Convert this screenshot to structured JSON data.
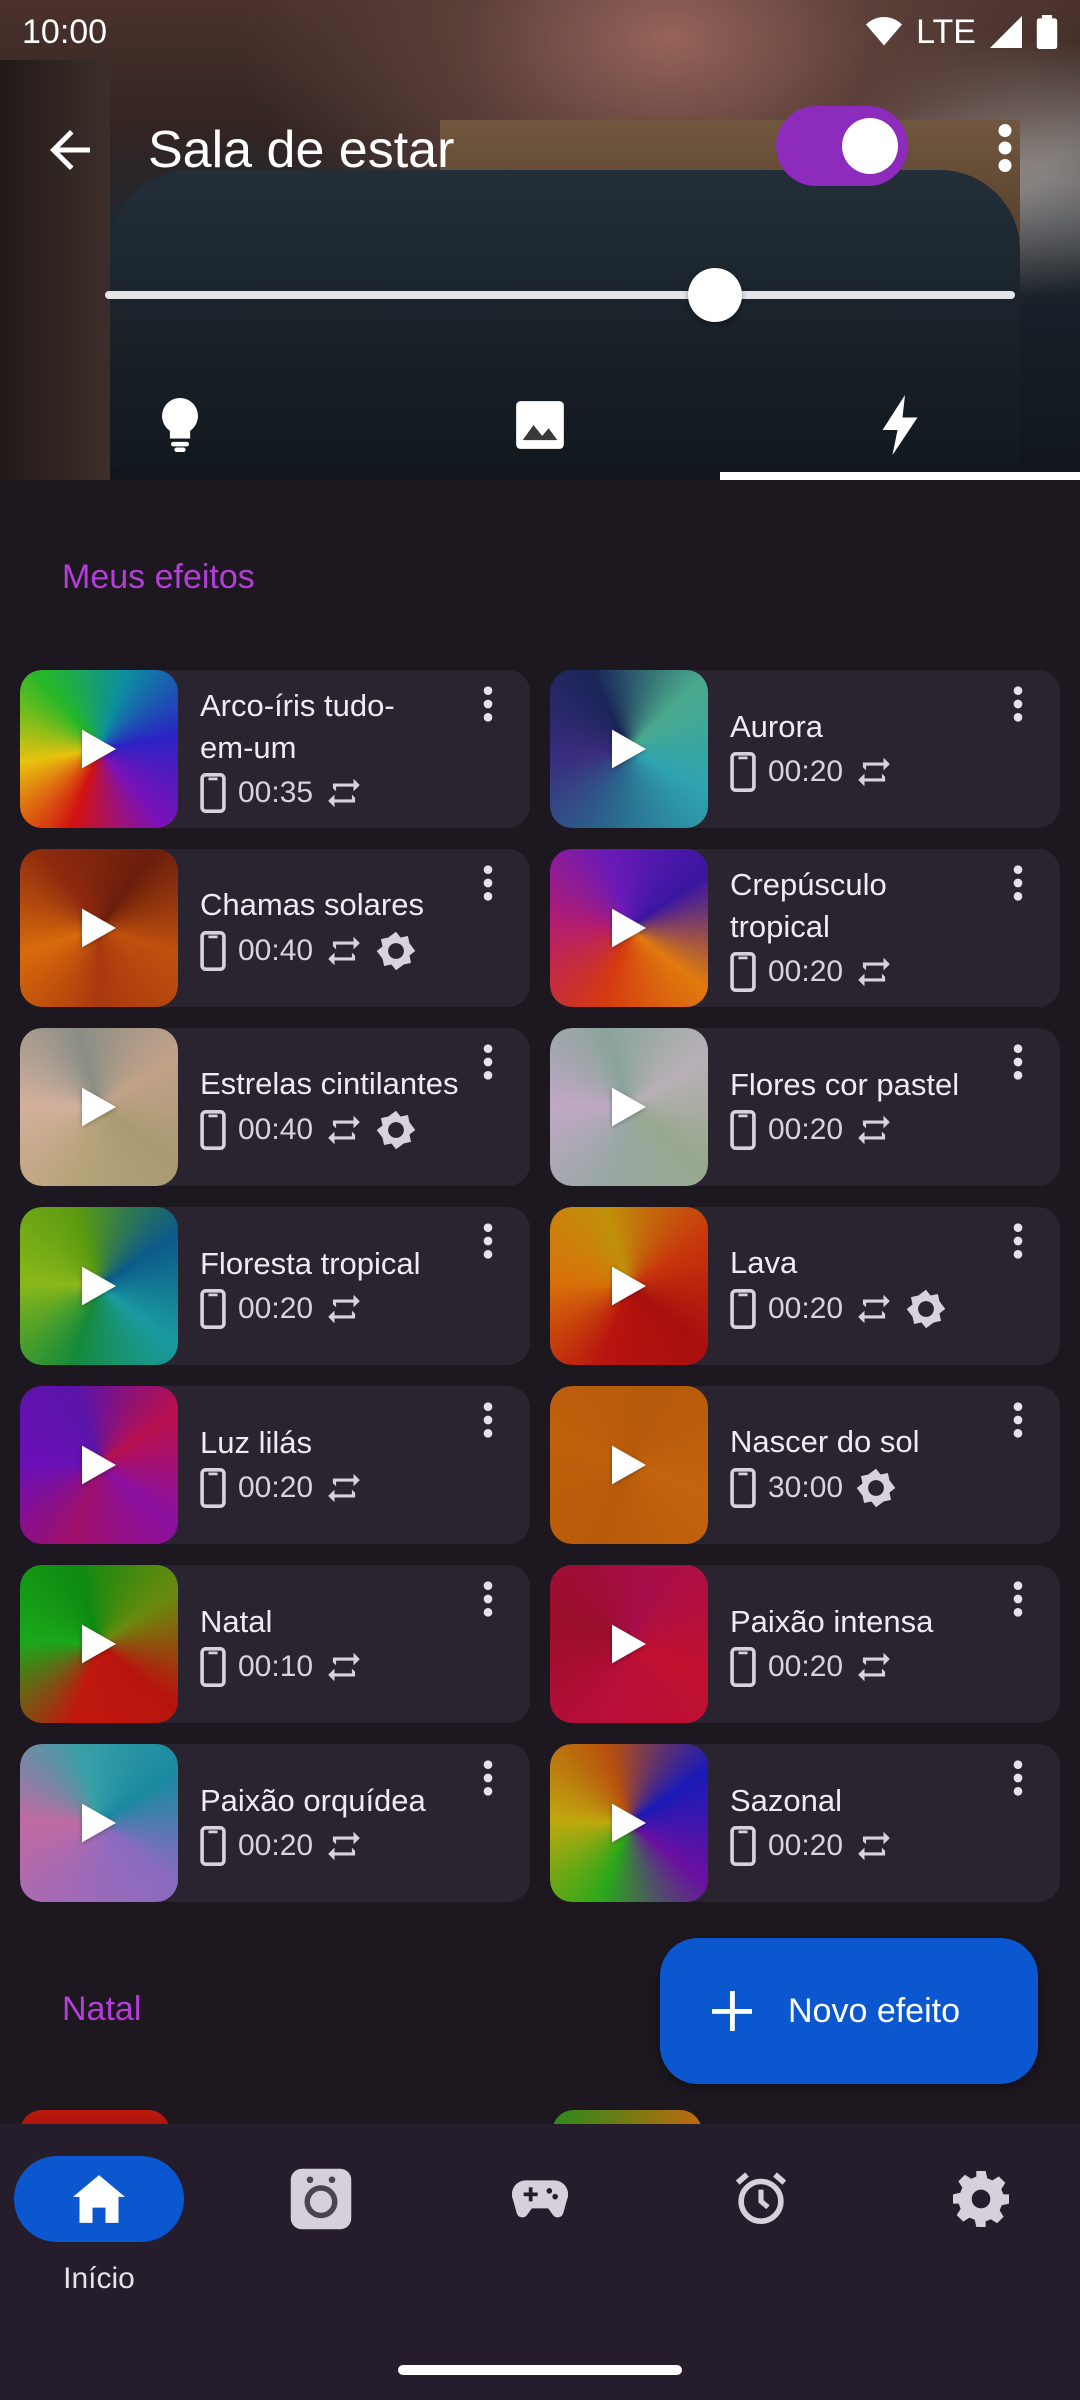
{
  "status_bar": {
    "time": "10:00",
    "network": "LTE",
    "icons": [
      "wifi-icon",
      "signal-icon",
      "battery-icon"
    ]
  },
  "header": {
    "title": "Sala de estar",
    "power_on": true,
    "brightness_fraction": 0.67
  },
  "tabs": [
    {
      "icon": "lightbulb-icon",
      "active": false
    },
    {
      "icon": "image-icon",
      "active": false
    },
    {
      "icon": "bolt-icon",
      "active": true
    }
  ],
  "section_my_effects": "Meus efeitos",
  "effects": [
    {
      "name": "Arco-íris tudo-em-um",
      "duration": "00:35",
      "repeat": true,
      "gear": false,
      "gradient": "conic-gradient(from 200deg, #d21212, #e8c20e, #26b826, #0c8e9e, #2b23c4, #7a12b8, #d21212)"
    },
    {
      "name": "Aurora",
      "duration": "00:20",
      "repeat": true,
      "gear": false,
      "gradient": "conic-gradient(from 190deg, #2a6b8e, #3a2c7e, #1a2558, #4aa98c, #2fa4b0, #2a6b8e)"
    },
    {
      "name": "Chamas solares",
      "duration": "00:40",
      "repeat": true,
      "gear": true,
      "gradient": "conic-gradient(from 180deg, #a8380e, #d86b0c, #8e2a0e, #6b1e0c, #c0500e, #a8380e)"
    },
    {
      "name": "Crepúsculo tropical",
      "duration": "00:20",
      "repeat": true,
      "gear": false,
      "gradient": "conic-gradient(from 200deg, #d43a10, #b51d6e, #6a1ab8, #3a16a0, #e07a0e, #d43a10)"
    },
    {
      "name": "Estrelas cintilantes",
      "duration": "00:40",
      "repeat": true,
      "gear": true,
      "gradient": "conic-gradient(from 200deg, #b7a47a, #d4b09c, #8a8e86, #c2a288, #a89a72, #b7a47a)"
    },
    {
      "name": "Flores cor pastel",
      "duration": "00:20",
      "repeat": true,
      "gear": false,
      "gradient": "conic-gradient(from 200deg, #9aa8a6, #c0a8c4, #8aa49a, #b8b0b6, #98a88e, #9aa8a6)"
    },
    {
      "name": "Floresta tropical",
      "duration": "00:20",
      "repeat": true,
      "gear": false,
      "gradient": "conic-gradient(from 200deg, #168a3a, #8ab81a, #5a9a10, #0c5a8a, #1a9aa0, #168a3a)"
    },
    {
      "name": "Lava",
      "duration": "00:20",
      "repeat": true,
      "gear": true,
      "gradient": "conic-gradient(from 200deg, #b8140e, #d8700a, #c0900a, #c8380c, #a8100e, #b8140e)"
    },
    {
      "name": "Luz lilás",
      "duration": "00:20",
      "repeat": true,
      "gear": false,
      "gradient": "conic-gradient(from 200deg, #a0106a, #6a10b8, #5a14a8, #b8104e, #8a10a0, #a0106a)"
    },
    {
      "name": "Nascer do sol",
      "duration": "30:00",
      "repeat": false,
      "gear": true,
      "gradient": "conic-gradient(from 200deg, #b85a0a, #c0600c, #b45a0a, #c4640e, #b85a0a)"
    },
    {
      "name": "Natal",
      "duration": "00:10",
      "repeat": true,
      "gear": false,
      "gradient": "conic-gradient(from 200deg, #c0180e, #1aa81a, #0e8a10, #6a8a0e, #b8140e, #c0180e)"
    },
    {
      "name": "Paixão intensa",
      "duration": "00:20",
      "repeat": true,
      "gear": false,
      "gradient": "conic-gradient(from 200deg, #b80e3a, #9a0e2a, #a80e4a, #c0102e, #b80e3a)"
    },
    {
      "name": "Paixão orquídea",
      "duration": "00:20",
      "repeat": true,
      "gear": false,
      "gradient": "conic-gradient(from 200deg, #a06ab8, #c06aa0, #3aa0a8, #1a8aa0, #8a6ac0, #a06ab8)"
    },
    {
      "name": "Sazonal",
      "duration": "00:20",
      "repeat": true,
      "gear": false,
      "gradient": "conic-gradient(from 200deg, #2aa81a, #c0a80e, #b8500e, #1a1ab8, #6a10a0, #2aa81a)"
    }
  ],
  "section_natal": "Natal",
  "fab": {
    "label": "Novo efeito",
    "icon": "plus-icon"
  },
  "bottom_nav": [
    {
      "label": "Início",
      "icon": "home-icon",
      "active": true
    },
    {
      "label": "",
      "icon": "device-icon",
      "active": false
    },
    {
      "label": "",
      "icon": "gamepad-icon",
      "active": false
    },
    {
      "label": "",
      "icon": "alarm-icon",
      "active": false
    },
    {
      "label": "",
      "icon": "settings-icon",
      "active": false
    }
  ]
}
